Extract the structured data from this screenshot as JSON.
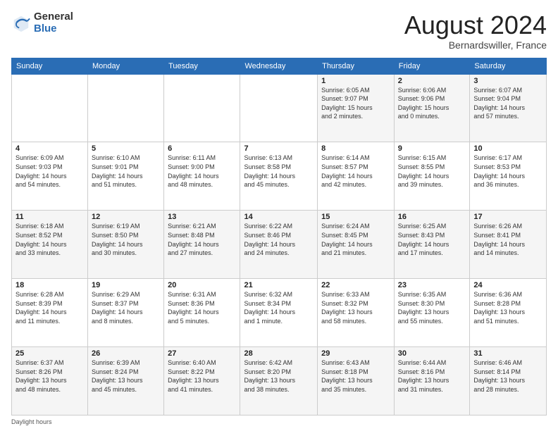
{
  "logo": {
    "general": "General",
    "blue": "Blue"
  },
  "title": {
    "month_year": "August 2024",
    "location": "Bernardswiller, France"
  },
  "headers": [
    "Sunday",
    "Monday",
    "Tuesday",
    "Wednesday",
    "Thursday",
    "Friday",
    "Saturday"
  ],
  "footer": "Daylight hours",
  "weeks": [
    [
      {
        "day": "",
        "info": ""
      },
      {
        "day": "",
        "info": ""
      },
      {
        "day": "",
        "info": ""
      },
      {
        "day": "",
        "info": ""
      },
      {
        "day": "1",
        "info": "Sunrise: 6:05 AM\nSunset: 9:07 PM\nDaylight: 15 hours\nand 2 minutes."
      },
      {
        "day": "2",
        "info": "Sunrise: 6:06 AM\nSunset: 9:06 PM\nDaylight: 15 hours\nand 0 minutes."
      },
      {
        "day": "3",
        "info": "Sunrise: 6:07 AM\nSunset: 9:04 PM\nDaylight: 14 hours\nand 57 minutes."
      }
    ],
    [
      {
        "day": "4",
        "info": "Sunrise: 6:09 AM\nSunset: 9:03 PM\nDaylight: 14 hours\nand 54 minutes."
      },
      {
        "day": "5",
        "info": "Sunrise: 6:10 AM\nSunset: 9:01 PM\nDaylight: 14 hours\nand 51 minutes."
      },
      {
        "day": "6",
        "info": "Sunrise: 6:11 AM\nSunset: 9:00 PM\nDaylight: 14 hours\nand 48 minutes."
      },
      {
        "day": "7",
        "info": "Sunrise: 6:13 AM\nSunset: 8:58 PM\nDaylight: 14 hours\nand 45 minutes."
      },
      {
        "day": "8",
        "info": "Sunrise: 6:14 AM\nSunset: 8:57 PM\nDaylight: 14 hours\nand 42 minutes."
      },
      {
        "day": "9",
        "info": "Sunrise: 6:15 AM\nSunset: 8:55 PM\nDaylight: 14 hours\nand 39 minutes."
      },
      {
        "day": "10",
        "info": "Sunrise: 6:17 AM\nSunset: 8:53 PM\nDaylight: 14 hours\nand 36 minutes."
      }
    ],
    [
      {
        "day": "11",
        "info": "Sunrise: 6:18 AM\nSunset: 8:52 PM\nDaylight: 14 hours\nand 33 minutes."
      },
      {
        "day": "12",
        "info": "Sunrise: 6:19 AM\nSunset: 8:50 PM\nDaylight: 14 hours\nand 30 minutes."
      },
      {
        "day": "13",
        "info": "Sunrise: 6:21 AM\nSunset: 8:48 PM\nDaylight: 14 hours\nand 27 minutes."
      },
      {
        "day": "14",
        "info": "Sunrise: 6:22 AM\nSunset: 8:46 PM\nDaylight: 14 hours\nand 24 minutes."
      },
      {
        "day": "15",
        "info": "Sunrise: 6:24 AM\nSunset: 8:45 PM\nDaylight: 14 hours\nand 21 minutes."
      },
      {
        "day": "16",
        "info": "Sunrise: 6:25 AM\nSunset: 8:43 PM\nDaylight: 14 hours\nand 17 minutes."
      },
      {
        "day": "17",
        "info": "Sunrise: 6:26 AM\nSunset: 8:41 PM\nDaylight: 14 hours\nand 14 minutes."
      }
    ],
    [
      {
        "day": "18",
        "info": "Sunrise: 6:28 AM\nSunset: 8:39 PM\nDaylight: 14 hours\nand 11 minutes."
      },
      {
        "day": "19",
        "info": "Sunrise: 6:29 AM\nSunset: 8:37 PM\nDaylight: 14 hours\nand 8 minutes."
      },
      {
        "day": "20",
        "info": "Sunrise: 6:31 AM\nSunset: 8:36 PM\nDaylight: 14 hours\nand 5 minutes."
      },
      {
        "day": "21",
        "info": "Sunrise: 6:32 AM\nSunset: 8:34 PM\nDaylight: 14 hours\nand 1 minute."
      },
      {
        "day": "22",
        "info": "Sunrise: 6:33 AM\nSunset: 8:32 PM\nDaylight: 13 hours\nand 58 minutes."
      },
      {
        "day": "23",
        "info": "Sunrise: 6:35 AM\nSunset: 8:30 PM\nDaylight: 13 hours\nand 55 minutes."
      },
      {
        "day": "24",
        "info": "Sunrise: 6:36 AM\nSunset: 8:28 PM\nDaylight: 13 hours\nand 51 minutes."
      }
    ],
    [
      {
        "day": "25",
        "info": "Sunrise: 6:37 AM\nSunset: 8:26 PM\nDaylight: 13 hours\nand 48 minutes."
      },
      {
        "day": "26",
        "info": "Sunrise: 6:39 AM\nSunset: 8:24 PM\nDaylight: 13 hours\nand 45 minutes."
      },
      {
        "day": "27",
        "info": "Sunrise: 6:40 AM\nSunset: 8:22 PM\nDaylight: 13 hours\nand 41 minutes."
      },
      {
        "day": "28",
        "info": "Sunrise: 6:42 AM\nSunset: 8:20 PM\nDaylight: 13 hours\nand 38 minutes."
      },
      {
        "day": "29",
        "info": "Sunrise: 6:43 AM\nSunset: 8:18 PM\nDaylight: 13 hours\nand 35 minutes."
      },
      {
        "day": "30",
        "info": "Sunrise: 6:44 AM\nSunset: 8:16 PM\nDaylight: 13 hours\nand 31 minutes."
      },
      {
        "day": "31",
        "info": "Sunrise: 6:46 AM\nSunset: 8:14 PM\nDaylight: 13 hours\nand 28 minutes."
      }
    ]
  ]
}
